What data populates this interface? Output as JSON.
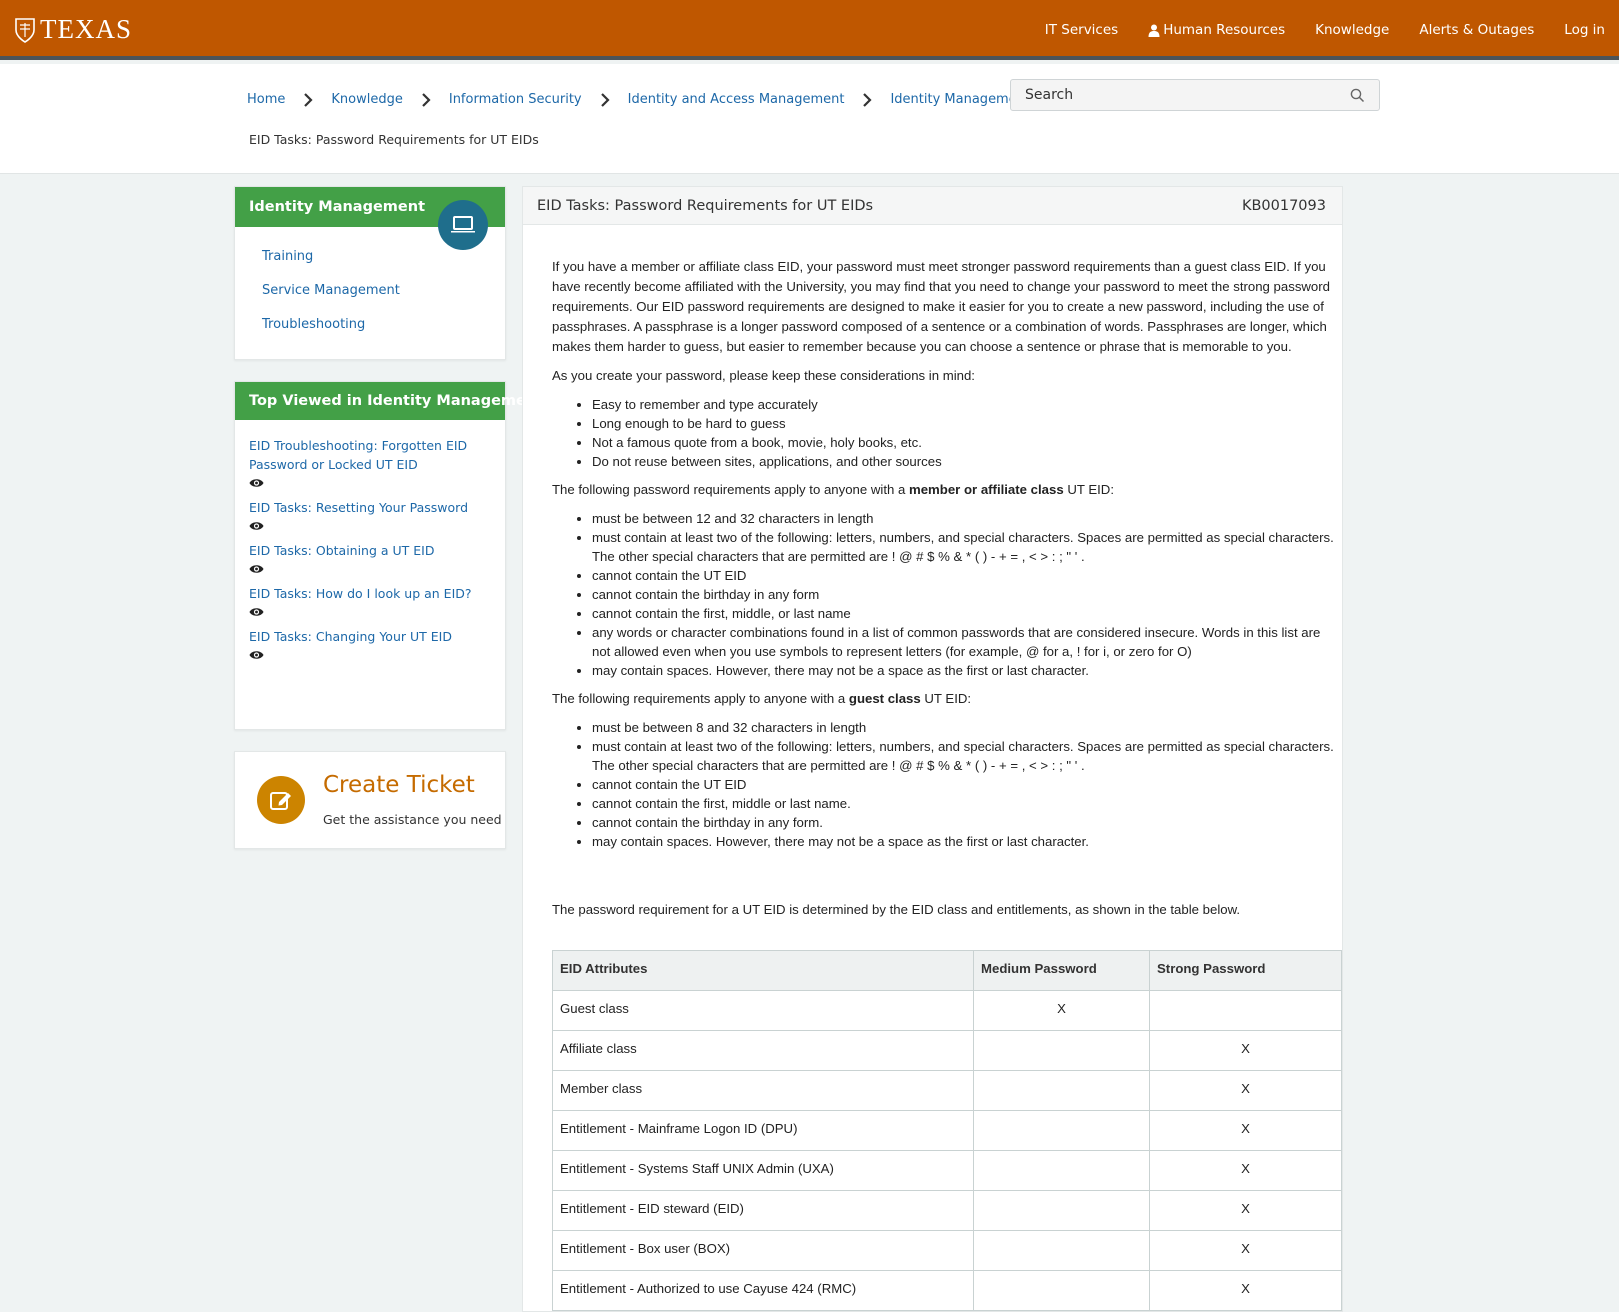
{
  "topbar": {
    "logo_text": "TEXAS",
    "nav": [
      "IT Services",
      "Human Resources",
      "Knowledge",
      "Alerts & Outages",
      "Log in"
    ]
  },
  "breadcrumb": {
    "items": [
      "Home",
      "Knowledge",
      "Information Security",
      "Identity and Access Management",
      "Identity Management"
    ],
    "current": "EID Tasks: Password Requirements for UT EIDs"
  },
  "search": {
    "placeholder": "Search"
  },
  "sidebar": {
    "idm": {
      "title": "Identity Management",
      "links": [
        "Training",
        "Service Management",
        "Troubleshooting"
      ]
    },
    "top_viewed": {
      "title": "Top Viewed in Identity Management",
      "items": [
        "EID Troubleshooting: Forgotten EID Password or Locked UT EID",
        "EID Tasks: Resetting Your Password",
        "EID Tasks: Obtaining a UT EID",
        "EID Tasks: How do I look up an EID?",
        "EID Tasks: Changing Your UT EID"
      ]
    },
    "ticket": {
      "title": "Create Ticket",
      "subtitle": "Get the assistance you need"
    }
  },
  "article": {
    "title": "EID Tasks: Password Requirements for UT EIDs",
    "kb_number": "KB0017093",
    "intro": "If you have a member or affiliate class EID, your password must meet stronger password requirements than a guest class EID. If you have recently become affiliated with the University, you may find that you need to change your password to meet the strong password requirements. Our EID password requirements are designed to make it easier for you to create a new password, including the use of passphrases. A passphrase is a longer password composed of a sentence or a combination of words. Passphrases are longer, which makes them harder to guess, but easier to remember because you can choose a sentence or phrase that is memorable to you.",
    "considerations_lead": "As you create your password, please keep these considerations in mind:",
    "considerations": [
      "Easy to remember and type accurately",
      "Long enough to be hard to guess",
      "Not a famous quote from a book, movie, holy books, etc.",
      "Do not reuse between sites, applications, and other sources"
    ],
    "member_lead_pre": "The following password requirements apply to anyone with a ",
    "member_lead_bold": "member or affiliate class",
    "member_lead_post": " UT EID:",
    "member_reqs": [
      "must be between 12 and 32 characters in length",
      "must contain at least two of the following: letters, numbers, and special characters. Spaces are permitted as special characters. The other special characters that are permitted are ! @ # $ % & * ( ) - + = , < > : ; \" ' .",
      "cannot contain the UT EID",
      "cannot contain the birthday in any form",
      "cannot contain the first, middle, or last name",
      "any words or character combinations found in a list of common passwords that are considered insecure. Words in this list are not allowed even when you use symbols to represent letters (for example, @ for a, ! for i, or zero for O)",
      "may contain spaces. However, there may not be a space as the first or last character."
    ],
    "guest_lead_pre": "The following requirements apply to anyone with a ",
    "guest_lead_bold": "guest class",
    "guest_lead_post": " UT EID:",
    "guest_reqs": [
      "must be between 8 and 32 characters in length",
      "must contain at least two of the following: letters, numbers, and special characters. Spaces are permitted as special characters. The other special characters that are permitted are ! @ # $ % & * ( ) - + = , < > : ; \" ' .",
      "cannot contain the UT EID",
      "cannot contain the first, middle or last name.",
      "cannot contain the birthday in any form.",
      "may contain spaces. However, there may not be a space as the first or last character."
    ],
    "table_lead": "The password requirement for a UT EID is determined by the EID class and entitlements, as shown in the table below.",
    "table": {
      "headers": [
        "EID Attributes",
        "Medium Password",
        "Strong Password"
      ],
      "rows": [
        [
          "Guest class",
          "X",
          ""
        ],
        [
          "Affiliate class",
          "",
          "X"
        ],
        [
          "Member class",
          "",
          "X"
        ],
        [
          "Entitlement - Mainframe Logon ID (DPU)",
          "",
          "X"
        ],
        [
          "Entitlement - Systems Staff UNIX Admin (UXA)",
          "",
          "X"
        ],
        [
          "Entitlement - EID steward (EID)",
          "",
          "X"
        ],
        [
          "Entitlement - Box user (BOX)",
          "",
          "X"
        ],
        [
          "Entitlement - Authorized to use Cayuse 424 (RMC)",
          "",
          "X"
        ]
      ]
    }
  }
}
